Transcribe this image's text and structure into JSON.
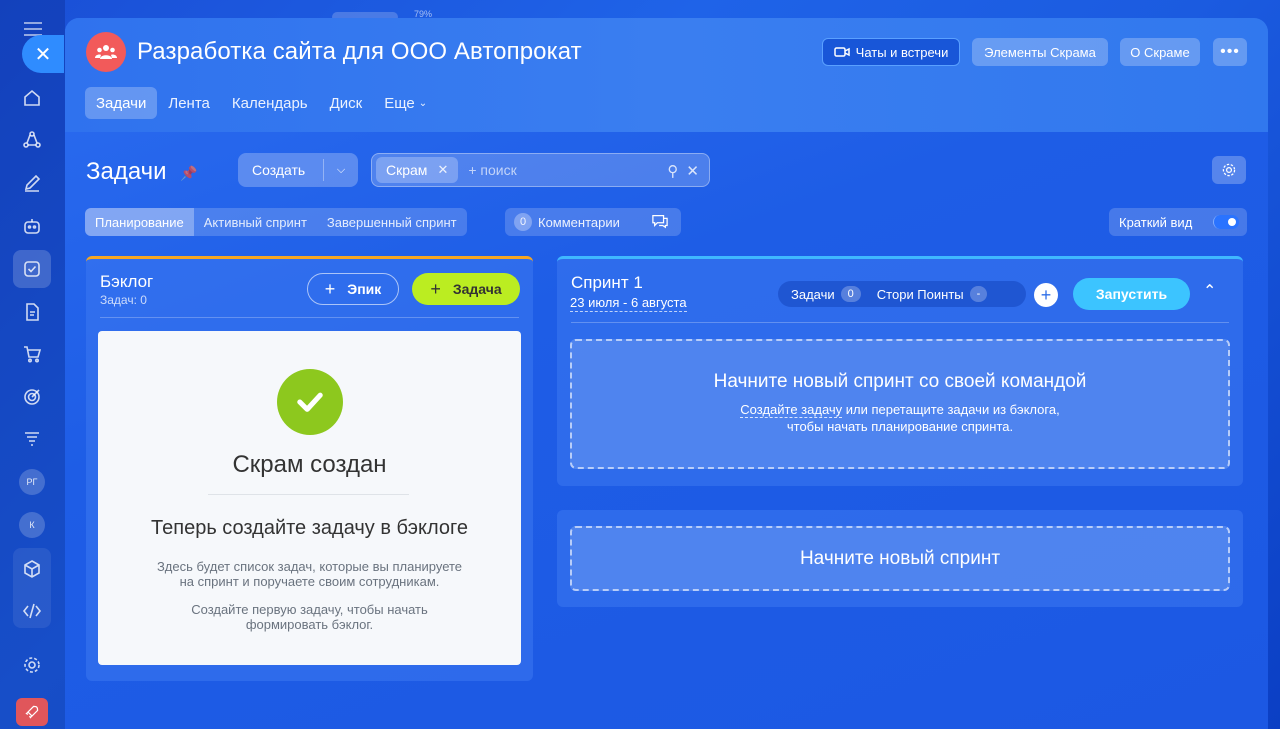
{
  "topbar": {
    "percent": "79%"
  },
  "header": {
    "project_title": "Разработка сайта для ООО Автопрокат",
    "buttons": {
      "chats": "Чаты и встречи",
      "scrum_elements": "Элементы Скрама",
      "about_scrum": "О Скраме",
      "more": "•••"
    },
    "tabs": [
      "Задачи",
      "Лента",
      "Календарь",
      "Диск",
      "Еще"
    ]
  },
  "rail": {
    "avatars": [
      "РГ",
      "К"
    ],
    "close": "✕"
  },
  "toolbar": {
    "page_title": "Задачи",
    "create_label": "Создать",
    "filter_chip": "Скрам",
    "search_placeholder": "+ поиск"
  },
  "view_tabs": [
    "Планирование",
    "Активный спринт",
    "Завершенный спринт"
  ],
  "comments": {
    "count": "0",
    "label": "Комментарии"
  },
  "compact_view": {
    "label": "Краткий вид"
  },
  "backlog": {
    "title": "Бэклог",
    "count_label": "Задач: 0",
    "epic_button": "Эпик",
    "task_button": "Задача",
    "card": {
      "heading": "Скрам создан",
      "subheading": "Теперь создайте задачу в бэклоге",
      "text1_line1": "Здесь будет список задач, которые вы планируете",
      "text1_line2": "на спринт и поручаете своим сотрудникам.",
      "text2_line1": "Создайте первую задачу, чтобы начать",
      "text2_line2": "формировать бэклог."
    }
  },
  "sprint": {
    "title": "Спринт 1",
    "dates": "23 июля - 6 августа",
    "tasks_label": "Задачи",
    "tasks_count": "0",
    "story_points_label": "Стори Поинты",
    "story_points_value": "-",
    "start_button": "Запустить",
    "drop_heading": "Начните новый спринт со своей командой",
    "drop_link": "Создайте задачу",
    "drop_text_rest": " или перетащите задачи из бэклога,",
    "drop_text_line2": "чтобы начать планирование спринта."
  },
  "new_sprint": {
    "label": "Начните новый спринт"
  }
}
